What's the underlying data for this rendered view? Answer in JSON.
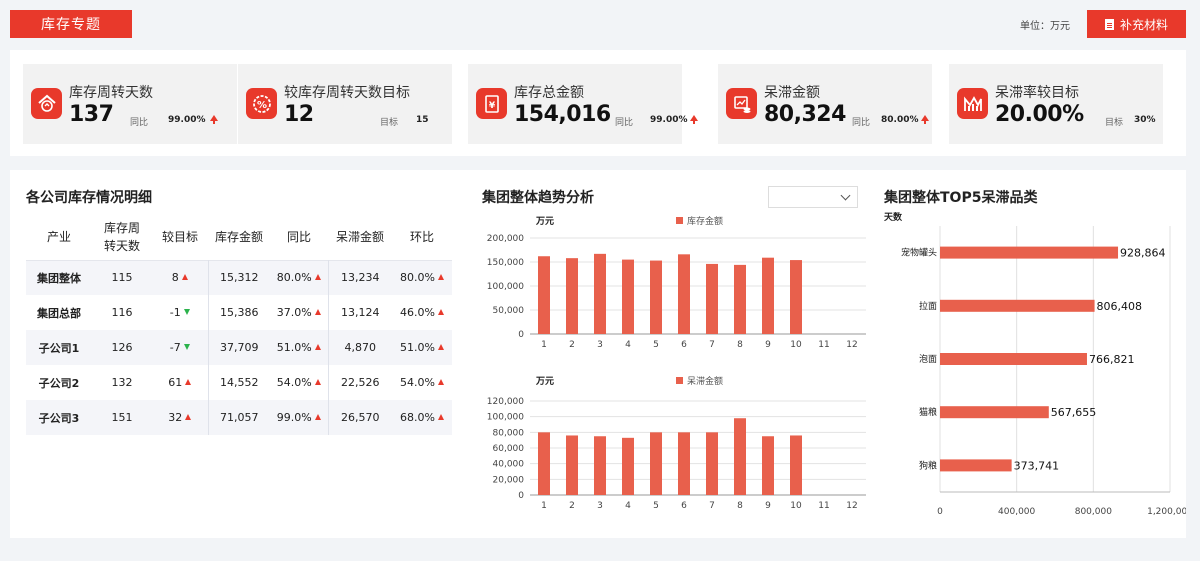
{
  "header": {
    "title": "库存专题",
    "unit": "单位：万元",
    "supplement_label": "补充材料"
  },
  "kpis": [
    {
      "title": "库存周转天数",
      "value": "137",
      "cmp_label": "同比",
      "cmp_value": "99.00%",
      "trend": "up",
      "icon": "warehouse-icon"
    },
    {
      "title": "较库存周转天数目标",
      "value": "12",
      "cmp_label": "目标",
      "cmp_value": "15",
      "trend": "none",
      "icon": "percent-icon"
    },
    {
      "title": "库存总金额",
      "value": "154,016",
      "cmp_label": "同比",
      "cmp_value": "99.00%",
      "trend": "up",
      "icon": "yen-icon"
    },
    {
      "title": "呆滞金额",
      "value": "80,324",
      "cmp_label": "同比",
      "cmp_value": "80.00%",
      "trend": "up",
      "icon": "money-stack-icon"
    },
    {
      "title": "呆滞率较目标",
      "value": "20.00%",
      "cmp_label": "目标",
      "cmp_value": "30%",
      "trend": "none",
      "icon": "rate-chart-icon"
    }
  ],
  "detail": {
    "title": "各公司库存情况明细",
    "columns": [
      "产业",
      "库存周转天数",
      "较目标",
      "库存金额",
      "同比",
      "呆滞金额",
      "环比"
    ],
    "rows": [
      {
        "name": "集团整体",
        "days": "115",
        "vs_target": "8",
        "vs_dir": "up",
        "amount": "15,312",
        "yoy": "80.0%",
        "stagnant": "13,234",
        "mom": "80.0%"
      },
      {
        "name": "集团总部",
        "days": "116",
        "vs_target": "-1",
        "vs_dir": "down",
        "amount": "15,386",
        "yoy": "37.0%",
        "stagnant": "13,124",
        "mom": "46.0%"
      },
      {
        "name": "子公司1",
        "days": "126",
        "vs_target": "-7",
        "vs_dir": "down",
        "amount": "37,709",
        "yoy": "51.0%",
        "stagnant": "4,870",
        "mom": "51.0%"
      },
      {
        "name": "子公司2",
        "days": "132",
        "vs_target": "61",
        "vs_dir": "up",
        "amount": "14,552",
        "yoy": "54.0%",
        "stagnant": "22,526",
        "mom": "54.0%"
      },
      {
        "name": "子公司3",
        "days": "151",
        "vs_target": "32",
        "vs_dir": "up",
        "amount": "71,057",
        "yoy": "99.0%",
        "stagnant": "26,570",
        "mom": "68.0%"
      }
    ]
  },
  "trend": {
    "title": "集团整体趋势分析",
    "dropdown_value": ""
  },
  "top5": {
    "title": "集团整体TOP5呆滞品类"
  },
  "colors": {
    "accent": "#e8392b",
    "bar": "#e8604c",
    "up": "#e8392b",
    "down": "#2bb24c"
  },
  "chart_data": [
    {
      "type": "bar",
      "ylabel": "万元",
      "categories": [
        "1",
        "2",
        "3",
        "4",
        "5",
        "6",
        "7",
        "8",
        "9",
        "10",
        "11",
        "12"
      ],
      "series": [
        {
          "name": "库存金额",
          "values": [
            162000,
            158000,
            167000,
            155000,
            153000,
            166000,
            146000,
            144000,
            159000,
            154000,
            null,
            null
          ]
        }
      ],
      "ylim": [
        0,
        200000
      ],
      "yticks": [
        0,
        50000,
        100000,
        150000,
        200000
      ],
      "ytick_labels": [
        "0",
        "50,000",
        "100,000",
        "150,000",
        "200,000"
      ],
      "grid": true,
      "legend": "top"
    },
    {
      "type": "bar",
      "ylabel": "万元",
      "categories": [
        "1",
        "2",
        "3",
        "4",
        "5",
        "6",
        "7",
        "8",
        "9",
        "10",
        "11",
        "12"
      ],
      "series": [
        {
          "name": "呆滞金额",
          "values": [
            80000,
            76000,
            75000,
            73000,
            80000,
            80000,
            80000,
            98000,
            75000,
            76000,
            null,
            null
          ]
        }
      ],
      "ylim": [
        0,
        120000
      ],
      "yticks": [
        0,
        20000,
        40000,
        60000,
        80000,
        100000,
        120000
      ],
      "ytick_labels": [
        "0",
        "20,000",
        "40,000",
        "60,000",
        "80,000",
        "100,000",
        "120,000"
      ],
      "grid": true,
      "legend": "top"
    },
    {
      "type": "bar",
      "orientation": "horizontal",
      "ylabel": "天数",
      "categories": [
        "宠物罐头",
        "拉面",
        "泡面",
        "猫粮",
        "狗粮"
      ],
      "values": [
        928864,
        806408,
        766821,
        567655,
        373741
      ],
      "data_labels": [
        "928,864",
        "806,408",
        "766,821",
        "567,655",
        "373,741"
      ],
      "xlim": [
        0,
        1200000
      ],
      "xticks": [
        0,
        400000,
        800000,
        1200000
      ],
      "xtick_labels": [
        "0",
        "400,000",
        "800,000",
        "1,200,000"
      ],
      "grid": true
    }
  ]
}
